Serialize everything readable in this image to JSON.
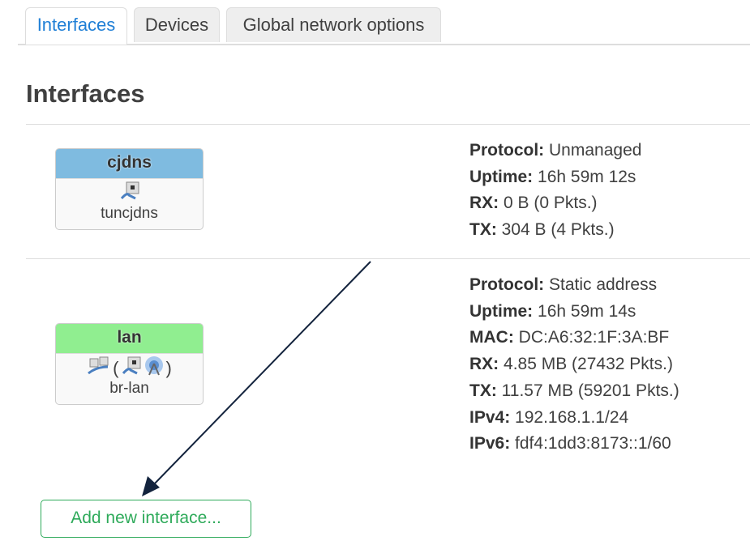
{
  "tabs": [
    {
      "label": "Interfaces",
      "active": true
    },
    {
      "label": "Devices"
    },
    {
      "label": "Global network options"
    }
  ],
  "page_title": "Interfaces",
  "interfaces": [
    {
      "name": "cjdns",
      "header_color": "#7fbbe0",
      "device": "tuncjdns",
      "icons": [
        "ethernet-port-icon"
      ],
      "info": [
        [
          "Protocol:",
          "Unmanaged"
        ],
        [
          "Uptime:",
          "16h 59m 12s"
        ],
        [
          "RX:",
          "0 B (0 Pkts.)"
        ],
        [
          "TX:",
          "304 B (4 Pkts.)"
        ]
      ]
    },
    {
      "name": "lan",
      "header_color": "#90ee90",
      "device": "br-lan",
      "icons": [
        "bridge-icon",
        "ethernet-port-icon",
        "wireless-icon"
      ],
      "paren_open": "(",
      "paren_close": ")",
      "info": [
        [
          "Protocol:",
          "Static address"
        ],
        [
          "Uptime:",
          "16h 59m 14s"
        ],
        [
          "MAC:",
          "DC:A6:32:1F:3A:BF"
        ],
        [
          "RX:",
          "4.85 MB (27432 Pkts.)"
        ],
        [
          "TX:",
          "11.57 MB (59201 Pkts.)"
        ],
        [
          "IPv4:",
          "192.168.1.1/24"
        ],
        [
          "IPv6:",
          "fdf4:1dd3:8173::1/60"
        ]
      ]
    }
  ],
  "add_button": "Add new interface..."
}
